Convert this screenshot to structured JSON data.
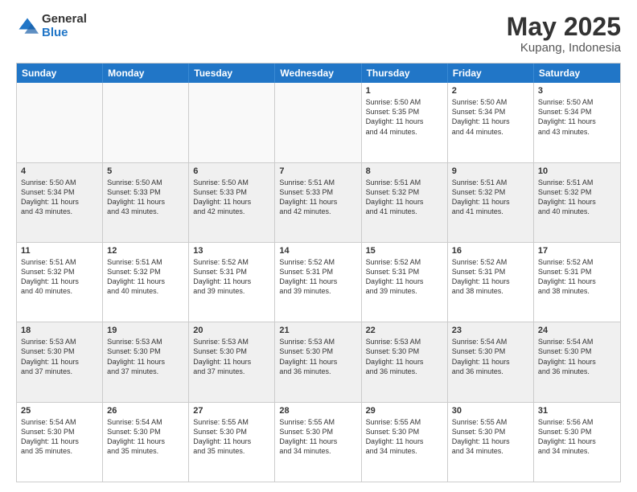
{
  "logo": {
    "general": "General",
    "blue": "Blue"
  },
  "title": "May 2025",
  "subtitle": "Kupang, Indonesia",
  "days": [
    "Sunday",
    "Monday",
    "Tuesday",
    "Wednesday",
    "Thursday",
    "Friday",
    "Saturday"
  ],
  "rows": [
    [
      {
        "day": "",
        "text": "",
        "empty": true
      },
      {
        "day": "",
        "text": "",
        "empty": true
      },
      {
        "day": "",
        "text": "",
        "empty": true
      },
      {
        "day": "",
        "text": "",
        "empty": true
      },
      {
        "day": "1",
        "text": "Sunrise: 5:50 AM\nSunset: 5:35 PM\nDaylight: 11 hours\nand 44 minutes.",
        "empty": false
      },
      {
        "day": "2",
        "text": "Sunrise: 5:50 AM\nSunset: 5:34 PM\nDaylight: 11 hours\nand 44 minutes.",
        "empty": false
      },
      {
        "day": "3",
        "text": "Sunrise: 5:50 AM\nSunset: 5:34 PM\nDaylight: 11 hours\nand 43 minutes.",
        "empty": false
      }
    ],
    [
      {
        "day": "4",
        "text": "Sunrise: 5:50 AM\nSunset: 5:34 PM\nDaylight: 11 hours\nand 43 minutes.",
        "empty": false
      },
      {
        "day": "5",
        "text": "Sunrise: 5:50 AM\nSunset: 5:33 PM\nDaylight: 11 hours\nand 43 minutes.",
        "empty": false
      },
      {
        "day": "6",
        "text": "Sunrise: 5:50 AM\nSunset: 5:33 PM\nDaylight: 11 hours\nand 42 minutes.",
        "empty": false
      },
      {
        "day": "7",
        "text": "Sunrise: 5:51 AM\nSunset: 5:33 PM\nDaylight: 11 hours\nand 42 minutes.",
        "empty": false
      },
      {
        "day": "8",
        "text": "Sunrise: 5:51 AM\nSunset: 5:32 PM\nDaylight: 11 hours\nand 41 minutes.",
        "empty": false
      },
      {
        "day": "9",
        "text": "Sunrise: 5:51 AM\nSunset: 5:32 PM\nDaylight: 11 hours\nand 41 minutes.",
        "empty": false
      },
      {
        "day": "10",
        "text": "Sunrise: 5:51 AM\nSunset: 5:32 PM\nDaylight: 11 hours\nand 40 minutes.",
        "empty": false
      }
    ],
    [
      {
        "day": "11",
        "text": "Sunrise: 5:51 AM\nSunset: 5:32 PM\nDaylight: 11 hours\nand 40 minutes.",
        "empty": false
      },
      {
        "day": "12",
        "text": "Sunrise: 5:51 AM\nSunset: 5:32 PM\nDaylight: 11 hours\nand 40 minutes.",
        "empty": false
      },
      {
        "day": "13",
        "text": "Sunrise: 5:52 AM\nSunset: 5:31 PM\nDaylight: 11 hours\nand 39 minutes.",
        "empty": false
      },
      {
        "day": "14",
        "text": "Sunrise: 5:52 AM\nSunset: 5:31 PM\nDaylight: 11 hours\nand 39 minutes.",
        "empty": false
      },
      {
        "day": "15",
        "text": "Sunrise: 5:52 AM\nSunset: 5:31 PM\nDaylight: 11 hours\nand 39 minutes.",
        "empty": false
      },
      {
        "day": "16",
        "text": "Sunrise: 5:52 AM\nSunset: 5:31 PM\nDaylight: 11 hours\nand 38 minutes.",
        "empty": false
      },
      {
        "day": "17",
        "text": "Sunrise: 5:52 AM\nSunset: 5:31 PM\nDaylight: 11 hours\nand 38 minutes.",
        "empty": false
      }
    ],
    [
      {
        "day": "18",
        "text": "Sunrise: 5:53 AM\nSunset: 5:30 PM\nDaylight: 11 hours\nand 37 minutes.",
        "empty": false
      },
      {
        "day": "19",
        "text": "Sunrise: 5:53 AM\nSunset: 5:30 PM\nDaylight: 11 hours\nand 37 minutes.",
        "empty": false
      },
      {
        "day": "20",
        "text": "Sunrise: 5:53 AM\nSunset: 5:30 PM\nDaylight: 11 hours\nand 37 minutes.",
        "empty": false
      },
      {
        "day": "21",
        "text": "Sunrise: 5:53 AM\nSunset: 5:30 PM\nDaylight: 11 hours\nand 36 minutes.",
        "empty": false
      },
      {
        "day": "22",
        "text": "Sunrise: 5:53 AM\nSunset: 5:30 PM\nDaylight: 11 hours\nand 36 minutes.",
        "empty": false
      },
      {
        "day": "23",
        "text": "Sunrise: 5:54 AM\nSunset: 5:30 PM\nDaylight: 11 hours\nand 36 minutes.",
        "empty": false
      },
      {
        "day": "24",
        "text": "Sunrise: 5:54 AM\nSunset: 5:30 PM\nDaylight: 11 hours\nand 36 minutes.",
        "empty": false
      }
    ],
    [
      {
        "day": "25",
        "text": "Sunrise: 5:54 AM\nSunset: 5:30 PM\nDaylight: 11 hours\nand 35 minutes.",
        "empty": false
      },
      {
        "day": "26",
        "text": "Sunrise: 5:54 AM\nSunset: 5:30 PM\nDaylight: 11 hours\nand 35 minutes.",
        "empty": false
      },
      {
        "day": "27",
        "text": "Sunrise: 5:55 AM\nSunset: 5:30 PM\nDaylight: 11 hours\nand 35 minutes.",
        "empty": false
      },
      {
        "day": "28",
        "text": "Sunrise: 5:55 AM\nSunset: 5:30 PM\nDaylight: 11 hours\nand 34 minutes.",
        "empty": false
      },
      {
        "day": "29",
        "text": "Sunrise: 5:55 AM\nSunset: 5:30 PM\nDaylight: 11 hours\nand 34 minutes.",
        "empty": false
      },
      {
        "day": "30",
        "text": "Sunrise: 5:55 AM\nSunset: 5:30 PM\nDaylight: 11 hours\nand 34 minutes.",
        "empty": false
      },
      {
        "day": "31",
        "text": "Sunrise: 5:56 AM\nSunset: 5:30 PM\nDaylight: 11 hours\nand 34 minutes.",
        "empty": false
      }
    ]
  ]
}
